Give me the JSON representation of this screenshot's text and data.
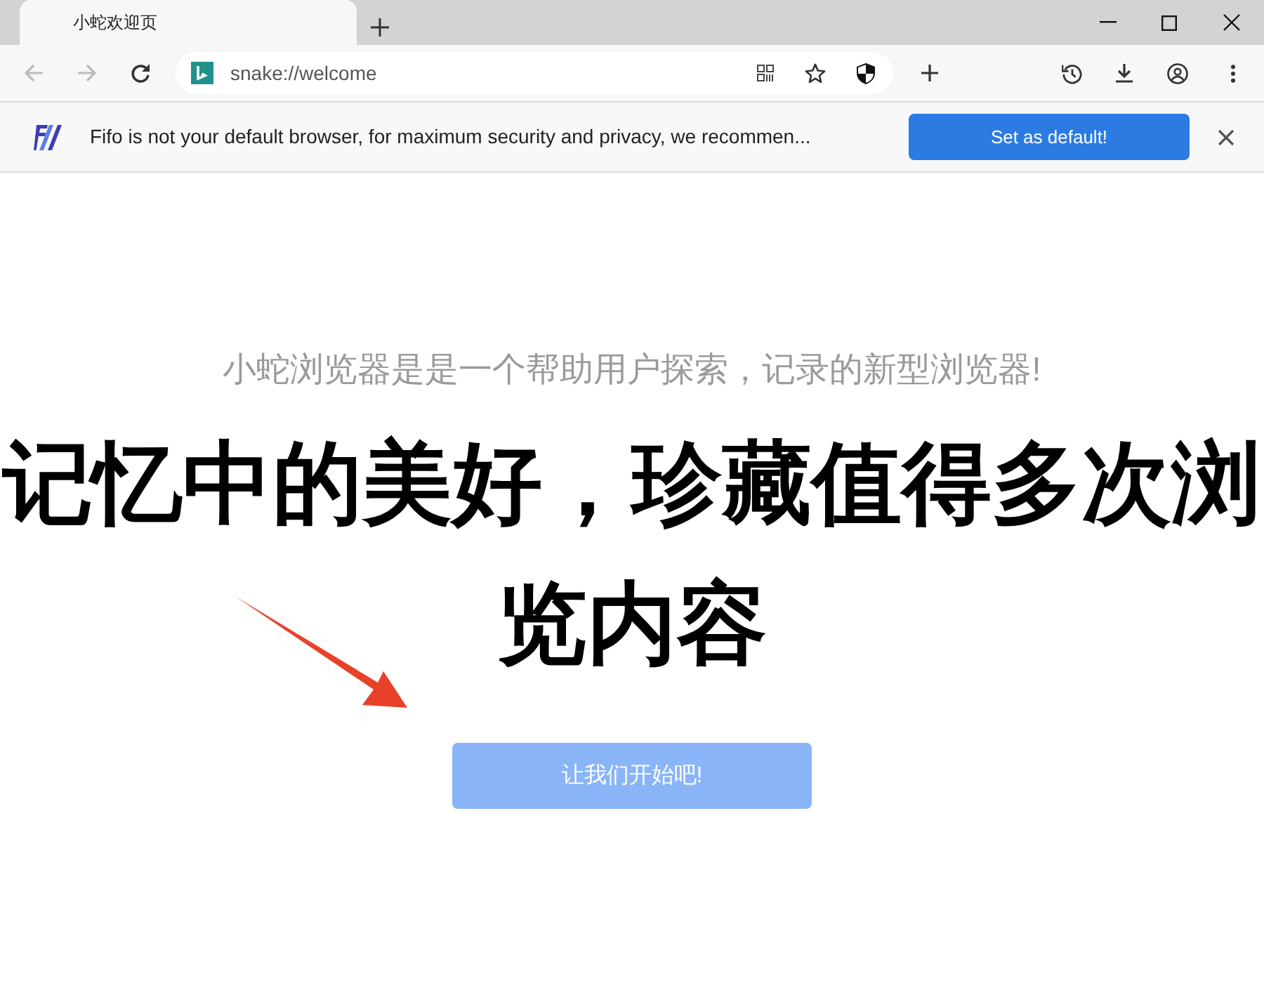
{
  "tabs": [
    {
      "title": "小蛇欢迎页",
      "selected": true
    }
  ],
  "address_bar": {
    "url": "snake://welcome"
  },
  "infobar": {
    "message": "Fifo is not your default browser, for maximum security and privacy, we recommen...",
    "button": "Set as default!"
  },
  "page": {
    "subtitle": "小蛇浏览器是是一个帮助用户探索，记录的新型浏览器!",
    "headline_lines": [
      "记忆中的美好，珍藏值得多次浏",
      "览内容"
    ],
    "start_button": "让我们开始吧!"
  }
}
